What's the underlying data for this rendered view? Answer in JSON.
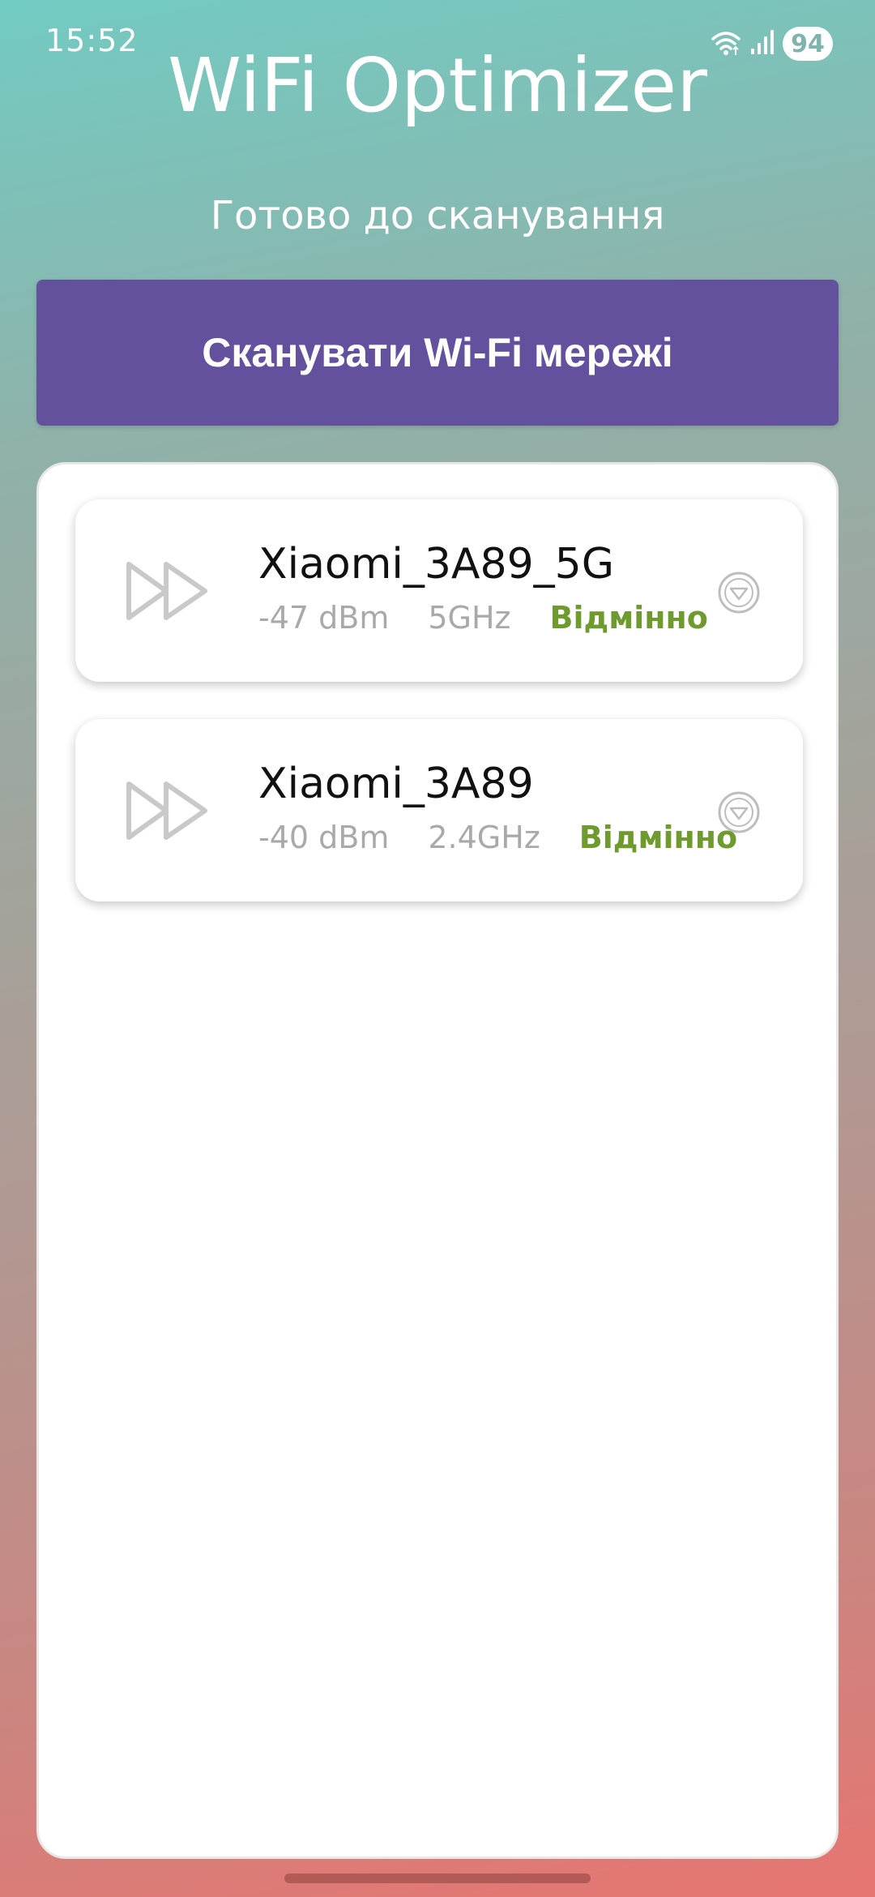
{
  "status_bar": {
    "time": "15:52",
    "battery": "94",
    "icons": [
      "wifi-icon",
      "signal-icon",
      "battery-icon"
    ]
  },
  "header": {
    "title": "WiFi Optimizer",
    "status": "Готово до сканування"
  },
  "scan_button": {
    "label": "Сканувати Wi-Fi мережі"
  },
  "networks": [
    {
      "ssid": "Xiaomi_3A89_5G",
      "signal": "-47 dBm",
      "band": "5GHz",
      "quality": "Відмінно",
      "icon": "fast-forward-icon",
      "action_icon": "expand-icon"
    },
    {
      "ssid": "Xiaomi_3A89",
      "signal": "-40 dBm",
      "band": "2.4GHz",
      "quality": "Відмінно",
      "icon": "fast-forward-icon",
      "action_icon": "expand-icon"
    }
  ],
  "colors": {
    "accent": "#63519e",
    "quality_good": "#6e9a2e",
    "muted_text": "#a9a9a9"
  }
}
